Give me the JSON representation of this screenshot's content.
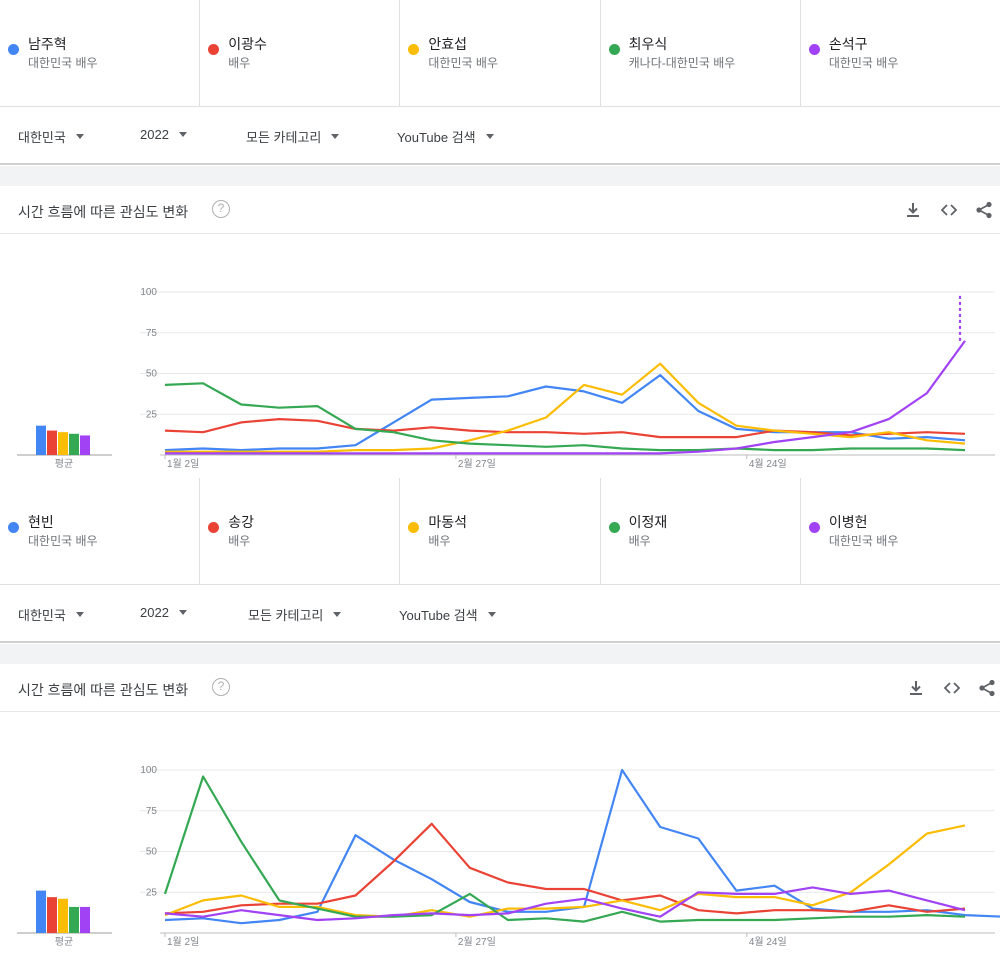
{
  "panels": [
    {
      "terms": [
        {
          "name": "남주혁",
          "subtitle": "대한민국 배우",
          "color": "#4285f4"
        },
        {
          "name": "이광수",
          "subtitle": "배우",
          "color": "#ea4335"
        },
        {
          "name": "안효섭",
          "subtitle": "대한민국 배우",
          "color": "#fbbc04"
        },
        {
          "name": "최우식",
          "subtitle": "캐나다-대한민국 배우",
          "color": "#34a853"
        },
        {
          "name": "손석구",
          "subtitle": "대한민국 배우",
          "color": "#a142f4"
        }
      ],
      "filters": {
        "region": "대한민국",
        "year": "2022",
        "category": "모든 카테고리",
        "search_type": "YouTube 검색"
      },
      "card_title": "시간 흐름에 따른 관심도 변화",
      "icons": [
        "help-icon",
        "download-icon",
        "embed-icon",
        "share-icon"
      ]
    },
    {
      "terms": [
        {
          "name": "현빈",
          "subtitle": "대한민국 배우",
          "color": "#4285f4"
        },
        {
          "name": "송강",
          "subtitle": "배우",
          "color": "#ea4335"
        },
        {
          "name": "마동석",
          "subtitle": "배우",
          "color": "#fbbc04"
        },
        {
          "name": "이정재",
          "subtitle": "배우",
          "color": "#34a853"
        },
        {
          "name": "이병헌",
          "subtitle": "대한민국 배우",
          "color": "#a142f4"
        }
      ],
      "filters": {
        "region": "대한민국",
        "year": "2022",
        "category": "모든 카테고리",
        "search_type": "YouTube 검색"
      },
      "card_title": "시간 흐름에 따른 관심도 변화",
      "icons": [
        "help-icon",
        "download-icon",
        "embed-icon",
        "share-icon"
      ]
    }
  ],
  "chart_data": [
    {
      "type": "line",
      "yticks": [
        25,
        50,
        75,
        100
      ],
      "ylim": [
        0,
        100
      ],
      "xlim": [
        0,
        22
      ],
      "xtick_labels": [
        {
          "label": "1월 2일",
          "x": 0
        },
        {
          "label": "2월 27일",
          "x": 8
        },
        {
          "label": "4월 24일",
          "x": 16
        }
      ],
      "average_label": "평균",
      "grid": true,
      "partial_from_index": 20,
      "series": [
        {
          "name": "남주혁",
          "color": "#4285f4",
          "average": 18,
          "values": [
            3,
            4,
            3,
            4,
            4,
            6,
            20,
            34,
            35,
            36,
            42,
            39,
            32,
            49,
            27,
            16,
            14,
            14,
            14,
            10,
            11,
            9
          ]
        },
        {
          "name": "이광수",
          "color": "#ea4335",
          "average": 15,
          "values": [
            15,
            14,
            20,
            22,
            21,
            16,
            15,
            17,
            15,
            14,
            14,
            13,
            14,
            11,
            11,
            11,
            15,
            14,
            12,
            13,
            14,
            13
          ]
        },
        {
          "name": "안효섭",
          "color": "#fbbc04",
          "average": 14,
          "values": [
            2,
            2,
            2,
            2,
            2,
            3,
            3,
            4,
            9,
            15,
            23,
            43,
            37,
            56,
            32,
            18,
            15,
            13,
            11,
            14,
            9,
            7
          ]
        },
        {
          "name": "최우식",
          "color": "#34a853",
          "average": 13,
          "values": [
            43,
            44,
            31,
            29,
            30,
            16,
            14,
            9,
            7,
            6,
            5,
            6,
            4,
            3,
            3,
            4,
            3,
            3,
            4,
            4,
            4,
            3
          ]
        },
        {
          "name": "손석구",
          "color": "#a142f4",
          "average": 12,
          "values": [
            1,
            1,
            1,
            1,
            1,
            1,
            1,
            1,
            1,
            1,
            1,
            1,
            1,
            1,
            2,
            4,
            8,
            11,
            14,
            22,
            38,
            70,
            99
          ]
        }
      ]
    },
    {
      "type": "line",
      "yticks": [
        25,
        50,
        75,
        100
      ],
      "ylim": [
        0,
        100
      ],
      "xlim": [
        0,
        22
      ],
      "xtick_labels": [
        {
          "label": "1월 2일",
          "x": 0
        },
        {
          "label": "2월 27일",
          "x": 8
        },
        {
          "label": "4월 24일",
          "x": 16
        }
      ],
      "average_label": "평균",
      "grid": true,
      "series": [
        {
          "name": "현빈",
          "color": "#4285f4",
          "average": 26,
          "values": [
            8,
            9,
            6,
            8,
            13,
            60,
            45,
            33,
            19,
            13,
            13,
            16,
            100,
            65,
            58,
            26,
            29,
            15,
            13,
            13,
            14,
            11,
            10
          ]
        },
        {
          "name": "송강",
          "color": "#ea4335",
          "average": 22,
          "values": [
            12,
            13,
            17,
            18,
            18,
            23,
            44,
            67,
            40,
            31,
            27,
            27,
            20,
            23,
            14,
            12,
            14,
            14,
            13,
            17,
            13,
            15
          ]
        },
        {
          "name": "마동석",
          "color": "#fbbc04",
          "average": 21,
          "values": [
            11,
            20,
            23,
            16,
            16,
            11,
            10,
            14,
            10,
            15,
            15,
            16,
            20,
            14,
            24,
            22,
            22,
            17,
            25,
            42,
            61,
            66
          ]
        },
        {
          "name": "이정재",
          "color": "#34a853",
          "average": 16,
          "values": [
            24,
            96,
            56,
            20,
            15,
            10,
            10,
            11,
            24,
            8,
            9,
            7,
            13,
            7,
            8,
            8,
            8,
            9,
            10,
            10,
            11,
            10
          ]
        },
        {
          "name": "이병헌",
          "color": "#a142f4",
          "average": 16,
          "values": [
            12,
            10,
            14,
            11,
            8,
            9,
            11,
            12,
            11,
            12,
            18,
            21,
            15,
            10,
            25,
            24,
            24,
            28,
            24,
            26,
            20,
            14
          ]
        }
      ]
    }
  ]
}
